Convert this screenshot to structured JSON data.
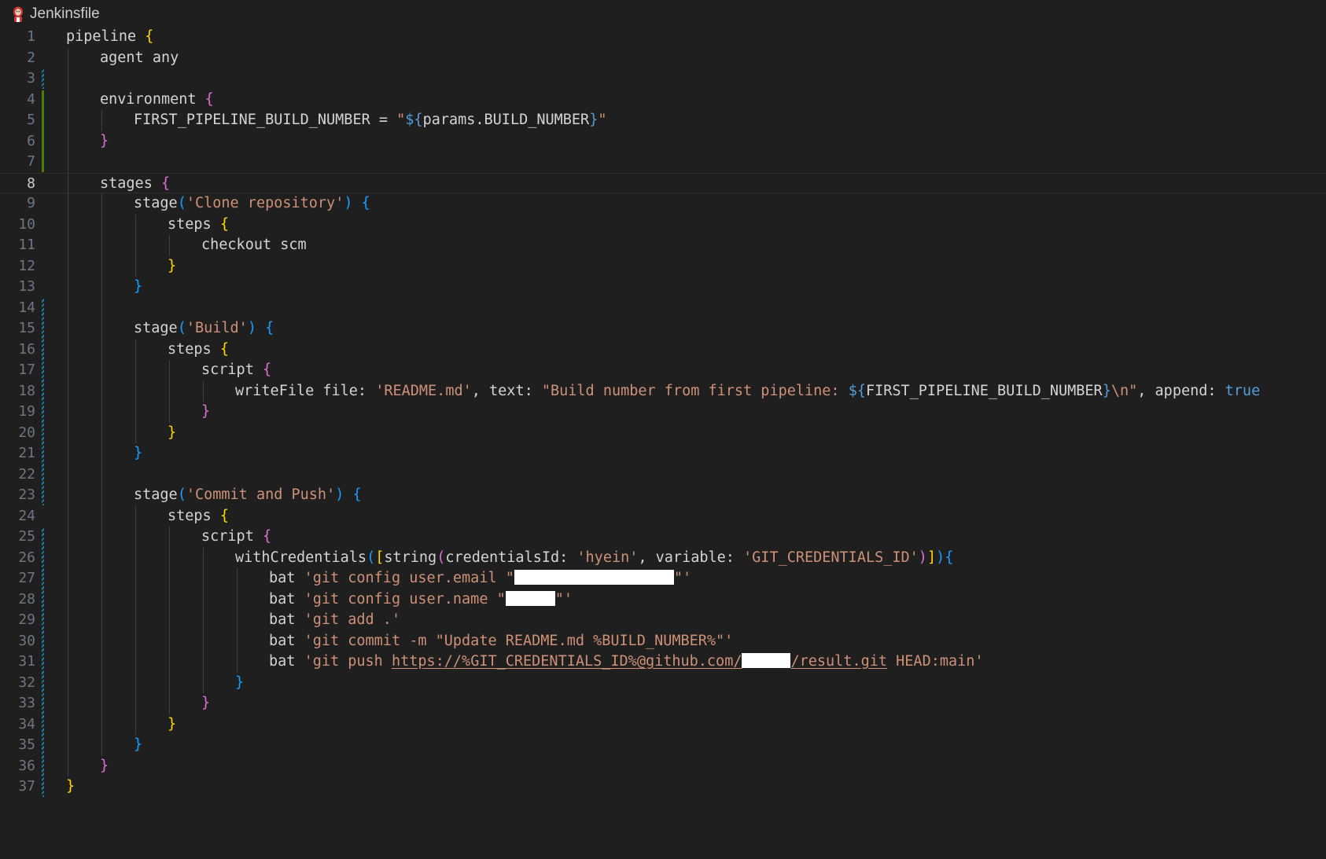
{
  "tab": {
    "file_name": "Jenkinsfile",
    "icon": "jenkins-icon"
  },
  "editor": {
    "current_line": 8,
    "line_numbers": [
      "1",
      "2",
      "3",
      "4",
      "5",
      "6",
      "7",
      "8",
      "9",
      "10",
      "11",
      "12",
      "13",
      "14",
      "15",
      "16",
      "17",
      "18",
      "19",
      "20",
      "21",
      "22",
      "23",
      "24",
      "25",
      "26",
      "27",
      "28",
      "29",
      "30",
      "31",
      "32",
      "33",
      "34",
      "35",
      "36",
      "37"
    ],
    "lines": [
      {
        "indent": 0,
        "tokens": [
          {
            "c": "t-text",
            "t": "pipeline "
          },
          {
            "c": "t-b1",
            "t": "{"
          }
        ]
      },
      {
        "indent": 1,
        "tokens": [
          {
            "c": "t-text",
            "t": "agent any"
          }
        ]
      },
      {
        "indent": 0,
        "tokens": []
      },
      {
        "indent": 1,
        "tokens": [
          {
            "c": "t-text",
            "t": "environment "
          },
          {
            "c": "t-b2",
            "t": "{"
          }
        ]
      },
      {
        "indent": 2,
        "tokens": [
          {
            "c": "t-text",
            "t": "FIRST_PIPELINE_BUILD_NUMBER = "
          },
          {
            "c": "t-str",
            "t": "\""
          },
          {
            "c": "t-kw",
            "t": "${"
          },
          {
            "c": "t-text",
            "t": "params.BUILD_NUMBER"
          },
          {
            "c": "t-kw",
            "t": "}"
          },
          {
            "c": "t-str",
            "t": "\""
          }
        ]
      },
      {
        "indent": 1,
        "tokens": [
          {
            "c": "t-b2",
            "t": "}"
          }
        ]
      },
      {
        "indent": 0,
        "tokens": []
      },
      {
        "indent": 1,
        "tokens": [
          {
            "c": "t-text",
            "t": "stages "
          },
          {
            "c": "t-b2",
            "t": "{"
          }
        ]
      },
      {
        "indent": 2,
        "tokens": [
          {
            "c": "t-text",
            "t": "stage"
          },
          {
            "c": "t-b3",
            "t": "("
          },
          {
            "c": "t-str",
            "t": "'Clone repository'"
          },
          {
            "c": "t-b3",
            "t": ")"
          },
          {
            "c": "t-text",
            "t": " "
          },
          {
            "c": "t-b3",
            "t": "{"
          }
        ]
      },
      {
        "indent": 3,
        "tokens": [
          {
            "c": "t-text",
            "t": "steps "
          },
          {
            "c": "t-b1",
            "t": "{"
          }
        ]
      },
      {
        "indent": 4,
        "tokens": [
          {
            "c": "t-text",
            "t": "checkout scm"
          }
        ]
      },
      {
        "indent": 3,
        "tokens": [
          {
            "c": "t-b1",
            "t": "}"
          }
        ]
      },
      {
        "indent": 2,
        "tokens": [
          {
            "c": "t-b3",
            "t": "}"
          }
        ]
      },
      {
        "indent": 0,
        "tokens": []
      },
      {
        "indent": 2,
        "tokens": [
          {
            "c": "t-text",
            "t": "stage"
          },
          {
            "c": "t-b3",
            "t": "("
          },
          {
            "c": "t-str",
            "t": "'Build'"
          },
          {
            "c": "t-b3",
            "t": ")"
          },
          {
            "c": "t-text",
            "t": " "
          },
          {
            "c": "t-b3",
            "t": "{"
          }
        ]
      },
      {
        "indent": 3,
        "tokens": [
          {
            "c": "t-text",
            "t": "steps "
          },
          {
            "c": "t-b1",
            "t": "{"
          }
        ]
      },
      {
        "indent": 4,
        "tokens": [
          {
            "c": "t-text",
            "t": "script "
          },
          {
            "c": "t-b2",
            "t": "{"
          }
        ]
      },
      {
        "indent": 5,
        "tokens": [
          {
            "c": "t-text",
            "t": "writeFile file: "
          },
          {
            "c": "t-str",
            "t": "'README.md'"
          },
          {
            "c": "t-text",
            "t": ", text: "
          },
          {
            "c": "t-str",
            "t": "\"Build number from first pipeline: "
          },
          {
            "c": "t-kw",
            "t": "${"
          },
          {
            "c": "t-text",
            "t": "FIRST_PIPELINE_BUILD_NUMBER"
          },
          {
            "c": "t-kw",
            "t": "}"
          },
          {
            "c": "t-str",
            "t": "\\n\""
          },
          {
            "c": "t-text",
            "t": ", append: "
          },
          {
            "c": "t-kw",
            "t": "true"
          }
        ]
      },
      {
        "indent": 4,
        "tokens": [
          {
            "c": "t-b2",
            "t": "}"
          }
        ]
      },
      {
        "indent": 3,
        "tokens": [
          {
            "c": "t-b1",
            "t": "}"
          }
        ]
      },
      {
        "indent": 2,
        "tokens": [
          {
            "c": "t-b3",
            "t": "}"
          }
        ]
      },
      {
        "indent": 0,
        "tokens": []
      },
      {
        "indent": 2,
        "tokens": [
          {
            "c": "t-text",
            "t": "stage"
          },
          {
            "c": "t-b3",
            "t": "("
          },
          {
            "c": "t-str",
            "t": "'Commit and Push'"
          },
          {
            "c": "t-b3",
            "t": ")"
          },
          {
            "c": "t-text",
            "t": " "
          },
          {
            "c": "t-b3",
            "t": "{"
          }
        ]
      },
      {
        "indent": 3,
        "tokens": [
          {
            "c": "t-text",
            "t": "steps "
          },
          {
            "c": "t-b1",
            "t": "{"
          }
        ]
      },
      {
        "indent": 4,
        "tokens": [
          {
            "c": "t-text",
            "t": "script "
          },
          {
            "c": "t-b2",
            "t": "{"
          }
        ]
      },
      {
        "indent": 5,
        "tokens": [
          {
            "c": "t-text",
            "t": "withCredentials"
          },
          {
            "c": "t-b3",
            "t": "("
          },
          {
            "c": "t-b1",
            "t": "["
          },
          {
            "c": "t-text",
            "t": "string"
          },
          {
            "c": "t-b2",
            "t": "("
          },
          {
            "c": "t-text",
            "t": "credentialsId: "
          },
          {
            "c": "t-str",
            "t": "'hyein'"
          },
          {
            "c": "t-text",
            "t": ", variable: "
          },
          {
            "c": "t-str",
            "t": "'GIT_CREDENTIALS_ID'"
          },
          {
            "c": "t-b2",
            "t": ")"
          },
          {
            "c": "t-b1",
            "t": "]"
          },
          {
            "c": "t-b3",
            "t": ")"
          },
          {
            "c": "t-b3",
            "t": "{"
          }
        ]
      },
      {
        "indent": 6,
        "tokens": [
          {
            "c": "t-text",
            "t": "bat "
          },
          {
            "c": "t-str",
            "t": "'git config user.email \""
          },
          {
            "c": "redact-email",
            "t": ""
          },
          {
            "c": "t-str",
            "t": "\"'"
          }
        ]
      },
      {
        "indent": 6,
        "tokens": [
          {
            "c": "t-text",
            "t": "bat "
          },
          {
            "c": "t-str",
            "t": "'git config user.name \""
          },
          {
            "c": "redact-name",
            "t": ""
          },
          {
            "c": "t-str",
            "t": "\"'"
          }
        ]
      },
      {
        "indent": 6,
        "tokens": [
          {
            "c": "t-text",
            "t": "bat "
          },
          {
            "c": "t-str",
            "t": "'git add .'"
          }
        ]
      },
      {
        "indent": 6,
        "tokens": [
          {
            "c": "t-text",
            "t": "bat "
          },
          {
            "c": "t-str",
            "t": "'git commit -m \"Update README.md %BUILD_NUMBER%\"'"
          }
        ]
      },
      {
        "indent": 6,
        "tokens": [
          {
            "c": "t-text",
            "t": "bat "
          },
          {
            "c": "t-str",
            "t": "'git push "
          },
          {
            "c": "t-link",
            "t": "https://%GIT_CREDENTIALS_ID%@github.com/"
          },
          {
            "c": "redact-user",
            "t": ""
          },
          {
            "c": "t-link",
            "t": "/result.git"
          },
          {
            "c": "t-str",
            "t": " HEAD:main'"
          }
        ]
      },
      {
        "indent": 5,
        "tokens": [
          {
            "c": "t-b3",
            "t": "}"
          }
        ]
      },
      {
        "indent": 4,
        "tokens": [
          {
            "c": "t-b2",
            "t": "}"
          }
        ]
      },
      {
        "indent": 3,
        "tokens": [
          {
            "c": "t-b1",
            "t": "}"
          }
        ]
      },
      {
        "indent": 2,
        "tokens": [
          {
            "c": "t-b3",
            "t": "}"
          }
        ]
      },
      {
        "indent": 1,
        "tokens": [
          {
            "c": "t-b2",
            "t": "}"
          }
        ]
      },
      {
        "indent": 0,
        "tokens": [
          {
            "c": "t-b1",
            "t": "}"
          }
        ]
      }
    ],
    "colors": {
      "background": "#1f1f1f",
      "text": "#d4d4d4",
      "bracket_gold": "#ffd700",
      "bracket_orchid": "#da70d6",
      "bracket_blue": "#179fff",
      "string": "#ce9178",
      "keyword": "#569cd6",
      "line_number": "#6e7681",
      "modified_green": "#487e02",
      "modified_blue": "#1b81a8"
    }
  }
}
